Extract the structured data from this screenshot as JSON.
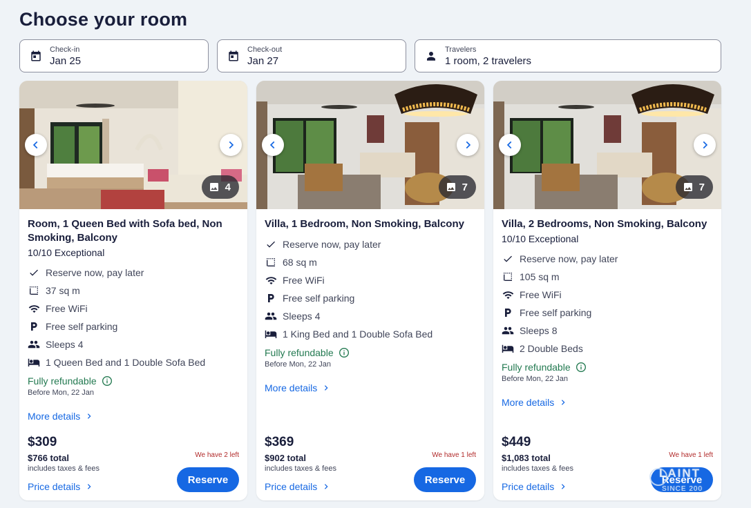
{
  "page": {
    "title": "Choose your room"
  },
  "search": {
    "checkin": {
      "label": "Check-in",
      "value": "Jan 25",
      "icon": "calendar-icon"
    },
    "checkout": {
      "label": "Check-out",
      "value": "Jan 27",
      "icon": "calendar-icon"
    },
    "travelers": {
      "label": "Travelers",
      "value": "1 room, 2 travelers",
      "icon": "person-icon"
    }
  },
  "rooms": [
    {
      "name": "Room, 1 Queen Bed with Sofa bed, Non Smoking, Balcony",
      "rating": "10/10 Exceptional",
      "photo_count": "4",
      "amenities": [
        {
          "icon": "check-icon",
          "text": "Reserve now, pay later"
        },
        {
          "icon": "area-icon",
          "text": "37 sq m"
        },
        {
          "icon": "wifi-icon",
          "text": "Free WiFi"
        },
        {
          "icon": "parking-icon",
          "text": "Free self parking"
        },
        {
          "icon": "people-icon",
          "text": "Sleeps 4"
        },
        {
          "icon": "bed-icon",
          "text": "1 Queen Bed and 1 Double Sofa Bed"
        }
      ],
      "refund": "Fully refundable",
      "refund_before": "Before Mon, 22 Jan",
      "more_details": "More details",
      "nightly": "$309",
      "total": "$766 total",
      "taxes": "includes taxes & fees",
      "left_note": "We have 2 left",
      "price_details": "Price details",
      "reserve": "Reserve"
    },
    {
      "name": "Villa, 1 Bedroom, Non Smoking, Balcony",
      "rating": "",
      "photo_count": "7",
      "amenities": [
        {
          "icon": "check-icon",
          "text": "Reserve now, pay later"
        },
        {
          "icon": "area-icon",
          "text": "68 sq m"
        },
        {
          "icon": "wifi-icon",
          "text": "Free WiFi"
        },
        {
          "icon": "parking-icon",
          "text": "Free self parking"
        },
        {
          "icon": "people-icon",
          "text": "Sleeps 4"
        },
        {
          "icon": "bed-icon",
          "text": "1 King Bed and 1 Double Sofa Bed"
        }
      ],
      "refund": "Fully refundable",
      "refund_before": "Before Mon, 22 Jan",
      "more_details": "More details",
      "nightly": "$369",
      "total": "$902 total",
      "taxes": "includes taxes & fees",
      "left_note": "We have 1 left",
      "price_details": "Price details",
      "reserve": "Reserve"
    },
    {
      "name": "Villa, 2 Bedrooms, Non Smoking, Balcony",
      "rating": "10/10 Exceptional",
      "photo_count": "7",
      "amenities": [
        {
          "icon": "check-icon",
          "text": "Reserve now, pay later"
        },
        {
          "icon": "area-icon",
          "text": "105 sq m"
        },
        {
          "icon": "wifi-icon",
          "text": "Free WiFi"
        },
        {
          "icon": "parking-icon",
          "text": "Free self parking"
        },
        {
          "icon": "people-icon",
          "text": "Sleeps 8"
        },
        {
          "icon": "bed-icon",
          "text": "2 Double Beds"
        }
      ],
      "refund": "Fully refundable",
      "refund_before": "Before Mon, 22 Jan",
      "more_details": "More details",
      "nightly": "$449",
      "total": "$1,083 total",
      "taxes": "includes taxes & fees",
      "left_note": "We have 1 left",
      "price_details": "Price details",
      "reserve": "Reserve"
    }
  ],
  "watermark": {
    "main": "LAINT",
    "sub": "SINCE 200"
  },
  "colors": {
    "brand_blue": "#1668e3",
    "refund_green": "#227950",
    "scarcity_red": "#b12a2a",
    "page_bg": "#eff3f7"
  }
}
